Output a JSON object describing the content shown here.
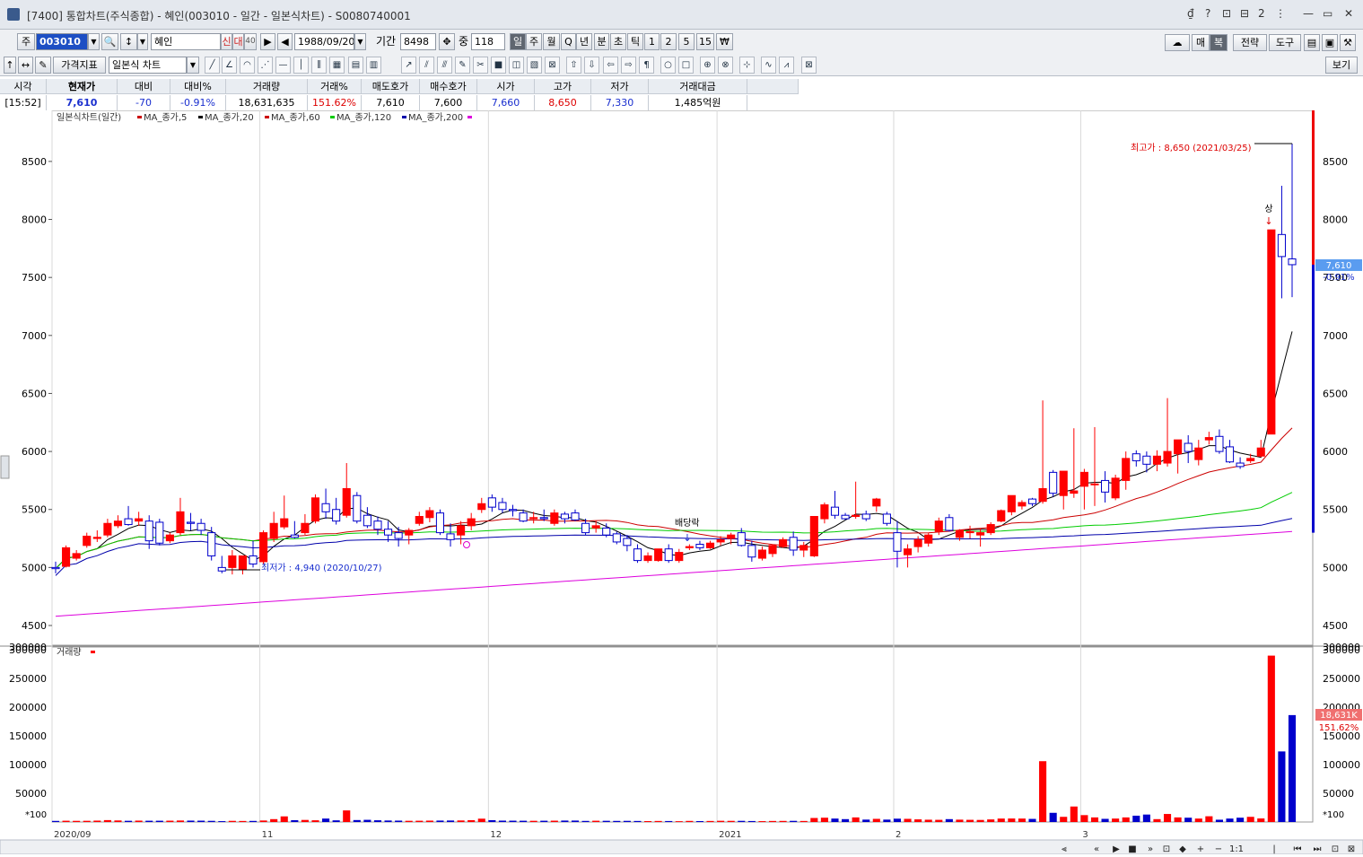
{
  "window": {
    "title": "[7400] 통합차트(주식종합) - 혜인(003010 - 일간 - 일본식차트) - S0080740001",
    "controls": [
      "₫",
      "?",
      "⊡",
      "⊟",
      "2",
      "⋮",
      "—",
      "▭",
      "✕"
    ]
  },
  "toolbar1": {
    "market_label": "주",
    "code_value": "003010",
    "stock_name": "혜인",
    "badge_sin": "신",
    "badge_dae": "대",
    "badge_40": "40",
    "date_value": "1988/09/20",
    "period_label": "기간",
    "period_value": "8498",
    "count_label": "중",
    "count_value": "118",
    "period_tabs": [
      "일",
      "주",
      "월",
      "Q",
      "년",
      "분",
      "초",
      "틱",
      "1",
      "2",
      "5",
      "15",
      "₩"
    ],
    "right_buttons": [
      "매",
      "복",
      "전략",
      "도구"
    ]
  },
  "toolbar2": {
    "indicator_button": "가격지표",
    "chart_type_value": "일본식 차트",
    "view_button": "보기"
  },
  "quote": {
    "headers": [
      "시각",
      "현재가",
      "대비",
      "대비%",
      "거래량",
      "거래%",
      "매도호가",
      "매수호가",
      "시가",
      "고가",
      "저가",
      "거래대금"
    ],
    "values": [
      "[15:52]",
      "7,610",
      "-70",
      "-0.91%",
      "18,631,635",
      "151.62%",
      "7,610",
      "7,600",
      "7,660",
      "8,650",
      "7,330",
      "1,485억원"
    ]
  },
  "colors": {
    "up": "#ff0000",
    "down": "#0000cc",
    "ma5": "#000000",
    "ma20": "#cc0000",
    "ma60": "#00cc00",
    "ma120": "#0000aa",
    "ma200": "#dd00dd",
    "accent": "#5a9cf0"
  },
  "chart_data": {
    "type": "candlestick",
    "legend_title": "일본식차트(일간)",
    "legend": [
      "MA_종가,5",
      "MA_종가,20",
      "MA_종가,60",
      "MA_종가,120",
      "MA_종가,200"
    ],
    "volume_legend": "거래량",
    "x_labels": [
      "2020/09",
      "11",
      "12",
      "2021",
      "2",
      "3"
    ],
    "price_ticks": [
      4500,
      5000,
      5500,
      6000,
      6500,
      7000,
      7500,
      8000,
      8500
    ],
    "volume_ticks": [
      50000,
      100000,
      150000,
      200000,
      250000,
      300000
    ],
    "volume_unit": "*100",
    "price_ylim": [
      4330,
      8940
    ],
    "volume_ylim": [
      0,
      305000
    ],
    "current_price_label": "7,610",
    "current_change_label": "-0.91%",
    "current_volume_label": "18,631K",
    "current_volume_pct_label": "151.62%",
    "high_annotation": "최고가 : 8,650 (2021/03/25)",
    "low_annotation": "최저가 : 4,940 (2020/10/27)",
    "dividend_label": "배당락",
    "limit_up_label": "상",
    "candles": [
      {
        "o": 5000,
        "h": 5050,
        "l": 4950,
        "c": 4990
      },
      {
        "o": 5010,
        "h": 5190,
        "l": 5000,
        "c": 5170
      },
      {
        "o": 5080,
        "h": 5150,
        "l": 5060,
        "c": 5120
      },
      {
        "o": 5190,
        "h": 5300,
        "l": 5170,
        "c": 5270
      },
      {
        "o": 5250,
        "h": 5320,
        "l": 5220,
        "c": 5260
      },
      {
        "o": 5280,
        "h": 5420,
        "l": 5260,
        "c": 5380
      },
      {
        "o": 5360,
        "h": 5450,
        "l": 5340,
        "c": 5400
      },
      {
        "o": 5420,
        "h": 5530,
        "l": 5360,
        "c": 5370
      },
      {
        "o": 5400,
        "h": 5480,
        "l": 5360,
        "c": 5420
      },
      {
        "o": 5400,
        "h": 5450,
        "l": 5160,
        "c": 5230
      },
      {
        "o": 5390,
        "h": 5420,
        "l": 5190,
        "c": 5210
      },
      {
        "o": 5230,
        "h": 5300,
        "l": 5210,
        "c": 5280
      },
      {
        "o": 5300,
        "h": 5600,
        "l": 5280,
        "c": 5480
      },
      {
        "o": 5390,
        "h": 5470,
        "l": 5320,
        "c": 5380
      },
      {
        "o": 5380,
        "h": 5420,
        "l": 5280,
        "c": 5320
      },
      {
        "o": 5300,
        "h": 5350,
        "l": 5060,
        "c": 5100
      },
      {
        "o": 5000,
        "h": 5100,
        "l": 4950,
        "c": 4970
      },
      {
        "o": 5000,
        "h": 5150,
        "l": 4940,
        "c": 5100
      },
      {
        "o": 4980,
        "h": 5100,
        "l": 4940,
        "c": 5100
      },
      {
        "o": 5100,
        "h": 5230,
        "l": 5000,
        "c": 5030
      },
      {
        "o": 5050,
        "h": 5320,
        "l": 5030,
        "c": 5300
      },
      {
        "o": 5250,
        "h": 5480,
        "l": 5220,
        "c": 5380
      },
      {
        "o": 5350,
        "h": 5620,
        "l": 5330,
        "c": 5420
      },
      {
        "o": 5280,
        "h": 5400,
        "l": 5250,
        "c": 5260
      },
      {
        "o": 5300,
        "h": 5460,
        "l": 5280,
        "c": 5380
      },
      {
        "o": 5400,
        "h": 5630,
        "l": 5380,
        "c": 5600
      },
      {
        "o": 5550,
        "h": 5680,
        "l": 5420,
        "c": 5480
      },
      {
        "o": 5500,
        "h": 5600,
        "l": 5370,
        "c": 5400
      },
      {
        "o": 5450,
        "h": 5900,
        "l": 5430,
        "c": 5680
      },
      {
        "o": 5620,
        "h": 5650,
        "l": 5380,
        "c": 5400
      },
      {
        "o": 5450,
        "h": 5520,
        "l": 5340,
        "c": 5360
      },
      {
        "o": 5400,
        "h": 5440,
        "l": 5280,
        "c": 5330
      },
      {
        "o": 5330,
        "h": 5400,
        "l": 5220,
        "c": 5280
      },
      {
        "o": 5300,
        "h": 5350,
        "l": 5180,
        "c": 5250
      },
      {
        "o": 5280,
        "h": 5340,
        "l": 5200,
        "c": 5320
      },
      {
        "o": 5380,
        "h": 5480,
        "l": 5360,
        "c": 5440
      },
      {
        "o": 5430,
        "h": 5520,
        "l": 5390,
        "c": 5490
      },
      {
        "o": 5470,
        "h": 5500,
        "l": 5280,
        "c": 5300
      },
      {
        "o": 5290,
        "h": 5380,
        "l": 5180,
        "c": 5240
      },
      {
        "o": 5280,
        "h": 5400,
        "l": 5200,
        "c": 5360
      },
      {
        "o": 5360,
        "h": 5470,
        "l": 5320,
        "c": 5420
      },
      {
        "o": 5500,
        "h": 5600,
        "l": 5470,
        "c": 5550
      },
      {
        "o": 5600,
        "h": 5630,
        "l": 5480,
        "c": 5520
      },
      {
        "o": 5560,
        "h": 5600,
        "l": 5470,
        "c": 5500
      },
      {
        "o": 5500,
        "h": 5540,
        "l": 5440,
        "c": 5490
      },
      {
        "o": 5470,
        "h": 5500,
        "l": 5390,
        "c": 5400
      },
      {
        "o": 5420,
        "h": 5480,
        "l": 5380,
        "c": 5430
      },
      {
        "o": 5430,
        "h": 5500,
        "l": 5400,
        "c": 5420
      },
      {
        "o": 5380,
        "h": 5500,
        "l": 5360,
        "c": 5470
      },
      {
        "o": 5460,
        "h": 5480,
        "l": 5380,
        "c": 5420
      },
      {
        "o": 5470,
        "h": 5500,
        "l": 5400,
        "c": 5410
      },
      {
        "o": 5380,
        "h": 5420,
        "l": 5280,
        "c": 5300
      },
      {
        "o": 5340,
        "h": 5400,
        "l": 5300,
        "c": 5360
      },
      {
        "o": 5340,
        "h": 5380,
        "l": 5260,
        "c": 5280
      },
      {
        "o": 5290,
        "h": 5310,
        "l": 5200,
        "c": 5220
      },
      {
        "o": 5250,
        "h": 5280,
        "l": 5140,
        "c": 5190
      },
      {
        "o": 5160,
        "h": 5200,
        "l": 5040,
        "c": 5060
      },
      {
        "o": 5060,
        "h": 5130,
        "l": 5040,
        "c": 5100
      },
      {
        "o": 5060,
        "h": 5160,
        "l": 5050,
        "c": 5160
      },
      {
        "o": 5160,
        "h": 5200,
        "l": 5040,
        "c": 5060
      },
      {
        "o": 5060,
        "h": 5160,
        "l": 5040,
        "c": 5130
      },
      {
        "o": 5170,
        "h": 5200,
        "l": 5150,
        "c": 5180
      },
      {
        "o": 5200,
        "h": 5230,
        "l": 5150,
        "c": 5170
      },
      {
        "o": 5170,
        "h": 5230,
        "l": 5160,
        "c": 5210
      },
      {
        "o": 5220,
        "h": 5270,
        "l": 5190,
        "c": 5240
      },
      {
        "o": 5250,
        "h": 5300,
        "l": 5200,
        "c": 5280
      },
      {
        "o": 5300,
        "h": 5340,
        "l": 5180,
        "c": 5190
      },
      {
        "o": 5190,
        "h": 5230,
        "l": 5050,
        "c": 5090
      },
      {
        "o": 5080,
        "h": 5180,
        "l": 5060,
        "c": 5150
      },
      {
        "o": 5120,
        "h": 5200,
        "l": 5090,
        "c": 5190
      },
      {
        "o": 5180,
        "h": 5260,
        "l": 5170,
        "c": 5240
      },
      {
        "o": 5260,
        "h": 5310,
        "l": 5100,
        "c": 5150
      },
      {
        "o": 5150,
        "h": 5220,
        "l": 5090,
        "c": 5190
      },
      {
        "o": 5100,
        "h": 5440,
        "l": 5090,
        "c": 5440
      },
      {
        "o": 5420,
        "h": 5560,
        "l": 5380,
        "c": 5540
      },
      {
        "o": 5520,
        "h": 5660,
        "l": 5420,
        "c": 5450
      },
      {
        "o": 5450,
        "h": 5470,
        "l": 5410,
        "c": 5420
      },
      {
        "o": 5440,
        "h": 5740,
        "l": 5420,
        "c": 5450
      },
      {
        "o": 5460,
        "h": 5490,
        "l": 5400,
        "c": 5420
      },
      {
        "o": 5530,
        "h": 5600,
        "l": 5480,
        "c": 5590
      },
      {
        "o": 5460,
        "h": 5480,
        "l": 5360,
        "c": 5380
      },
      {
        "o": 5300,
        "h": 5400,
        "l": 5000,
        "c": 5140
      },
      {
        "o": 5110,
        "h": 5200,
        "l": 5000,
        "c": 5160
      },
      {
        "o": 5180,
        "h": 5270,
        "l": 5130,
        "c": 5240
      },
      {
        "o": 5210,
        "h": 5300,
        "l": 5180,
        "c": 5280
      },
      {
        "o": 5310,
        "h": 5430,
        "l": 5280,
        "c": 5400
      },
      {
        "o": 5430,
        "h": 5460,
        "l": 5310,
        "c": 5320
      },
      {
        "o": 5260,
        "h": 5330,
        "l": 5230,
        "c": 5320
      },
      {
        "o": 5300,
        "h": 5360,
        "l": 5250,
        "c": 5310
      },
      {
        "o": 5280,
        "h": 5340,
        "l": 5180,
        "c": 5300
      },
      {
        "o": 5300,
        "h": 5390,
        "l": 5280,
        "c": 5370
      },
      {
        "o": 5400,
        "h": 5500,
        "l": 5390,
        "c": 5490
      },
      {
        "o": 5480,
        "h": 5620,
        "l": 5450,
        "c": 5620
      },
      {
        "o": 5530,
        "h": 5580,
        "l": 5500,
        "c": 5560
      },
      {
        "o": 5590,
        "h": 5600,
        "l": 5530,
        "c": 5550
      },
      {
        "o": 5570,
        "h": 6440,
        "l": 5550,
        "c": 5680
      },
      {
        "o": 5820,
        "h": 5840,
        "l": 5610,
        "c": 5640
      },
      {
        "o": 5620,
        "h": 5830,
        "l": 5500,
        "c": 5830
      },
      {
        "o": 5640,
        "h": 6200,
        "l": 5600,
        "c": 5660
      },
      {
        "o": 5700,
        "h": 5850,
        "l": 5500,
        "c": 5820
      },
      {
        "o": 5720,
        "h": 6210,
        "l": 5530,
        "c": 5720
      },
      {
        "o": 5750,
        "h": 5830,
        "l": 5560,
        "c": 5650
      },
      {
        "o": 5600,
        "h": 5800,
        "l": 5580,
        "c": 5770
      },
      {
        "o": 5750,
        "h": 6000,
        "l": 5670,
        "c": 5940
      },
      {
        "o": 5980,
        "h": 6010,
        "l": 5870,
        "c": 5920
      },
      {
        "o": 5960,
        "h": 6000,
        "l": 5820,
        "c": 5890
      },
      {
        "o": 5890,
        "h": 6010,
        "l": 5830,
        "c": 5960
      },
      {
        "o": 5900,
        "h": 6460,
        "l": 5870,
        "c": 6000
      },
      {
        "o": 5980,
        "h": 6000,
        "l": 5810,
        "c": 6100
      },
      {
        "o": 6070,
        "h": 6140,
        "l": 5900,
        "c": 6000
      },
      {
        "o": 5930,
        "h": 6100,
        "l": 5880,
        "c": 6030
      },
      {
        "o": 6100,
        "h": 6170,
        "l": 6060,
        "c": 6120
      },
      {
        "o": 6130,
        "h": 6190,
        "l": 5980,
        "c": 6000
      },
      {
        "o": 6040,
        "h": 6100,
        "l": 5900,
        "c": 5910
      },
      {
        "o": 5900,
        "h": 5950,
        "l": 5850,
        "c": 5870
      },
      {
        "o": 5920,
        "h": 5980,
        "l": 5900,
        "c": 5940
      },
      {
        "o": 5960,
        "h": 6100,
        "l": 5950,
        "c": 6030
      },
      {
        "o": 6150,
        "h": 7910,
        "l": 6150,
        "c": 7910
      },
      {
        "o": 7870,
        "h": 8290,
        "l": 7320,
        "c": 7680
      },
      {
        "o": 7660,
        "h": 8650,
        "l": 7330,
        "c": 7610
      }
    ],
    "volume_x100": [
      1900,
      2200,
      2000,
      2100,
      2400,
      3300,
      2700,
      2100,
      2400,
      2200,
      2200,
      2300,
      2600,
      2400,
      2300,
      2000,
      1500,
      2000,
      1800,
      1900,
      2600,
      5000,
      9800,
      3200,
      3600,
      3000,
      6000,
      2900,
      20200,
      3400,
      3800,
      3000,
      2600,
      2400,
      2100,
      2200,
      2400,
      2500,
      2600,
      2700,
      3200,
      5800,
      3200,
      2400,
      2300,
      2200,
      2100,
      2200,
      2300,
      2500,
      2500,
      1900,
      2200,
      2100,
      1900,
      2000,
      1800,
      1600,
      1800,
      1700,
      1400,
      1900,
      1600,
      1800,
      2100,
      2000,
      2000,
      1700,
      1500,
      1800,
      1900,
      2000,
      1800,
      7000,
      7500,
      6000,
      5000,
      8000,
      4200,
      5500,
      4200,
      5800,
      5500,
      4600,
      4000,
      3800,
      5000,
      4100,
      3800,
      3600,
      4500,
      6000,
      6100,
      6000,
      5400,
      106000,
      16000,
      9000,
      27000,
      12000,
      8000,
      5500,
      6000,
      8000,
      11000,
      13000,
      5000,
      14000,
      8000,
      7500,
      6000,
      10000,
      4000,
      6000,
      7500,
      9000,
      6200,
      290000,
      123000,
      186316
    ],
    "ma_values_note": "",
    "x_range": [
      0,
      119
    ]
  }
}
